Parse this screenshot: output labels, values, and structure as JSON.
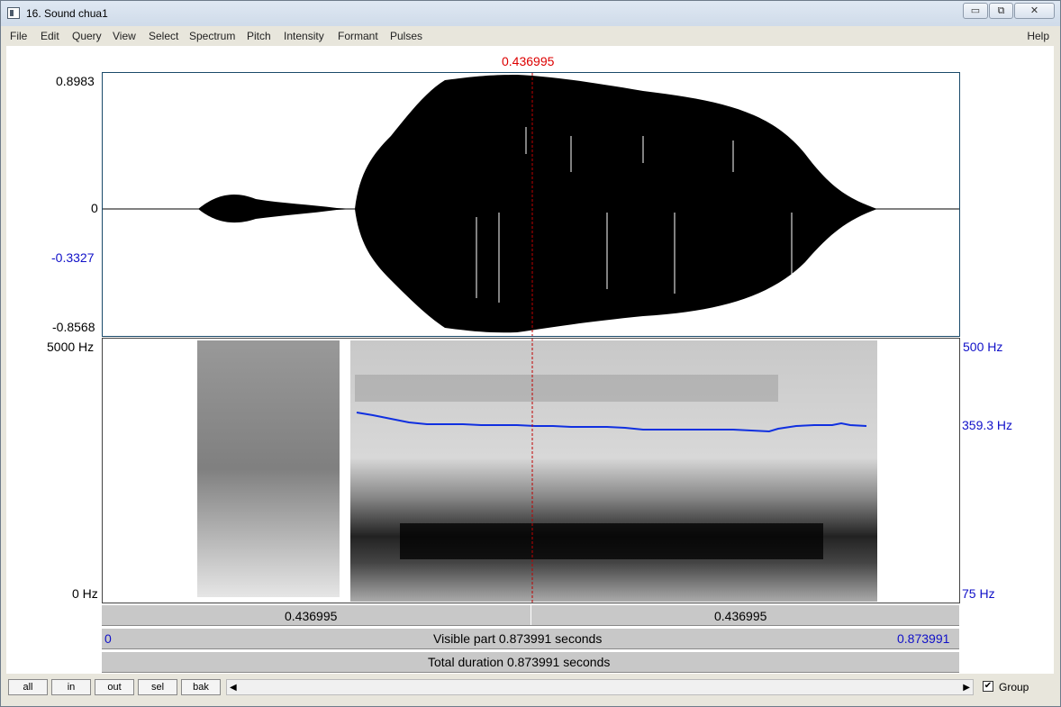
{
  "window": {
    "title": "16. Sound chua1",
    "buttons": [
      "▭",
      "⧉",
      "✕"
    ]
  },
  "menu": {
    "items": [
      "File",
      "Edit",
      "Query",
      "View",
      "Select",
      "Spectrum",
      "Pitch",
      "Intensity",
      "Formant",
      "Pulses"
    ],
    "help": "Help"
  },
  "cursor": {
    "time": "0.436995"
  },
  "waveform": {
    "ymax_label": "0.8983",
    "zero_label": "0",
    "cursor_value_label": "-0.3327",
    "ymin_label": "-0.8568"
  },
  "spectrogram": {
    "freq_top_label": "5000 Hz",
    "freq_bottom_label": "0 Hz",
    "pitch_top_label": "500 Hz",
    "pitch_cursor_label": "359.3 Hz",
    "pitch_bottom_label": "75 Hz"
  },
  "bars": {
    "left_segment": "0.436995",
    "right_segment": "0.436995",
    "visible_start": "0",
    "visible_text": "Visible part 0.873991 seconds",
    "visible_end": "0.873991",
    "total_text": "Total duration 0.873991 seconds"
  },
  "toolbar": {
    "buttons": [
      "all",
      "in",
      "out",
      "sel",
      "bak"
    ],
    "scroll_left": "◀",
    "scroll_right": "▶",
    "group_checked": "✔",
    "group_label": "Group"
  }
}
